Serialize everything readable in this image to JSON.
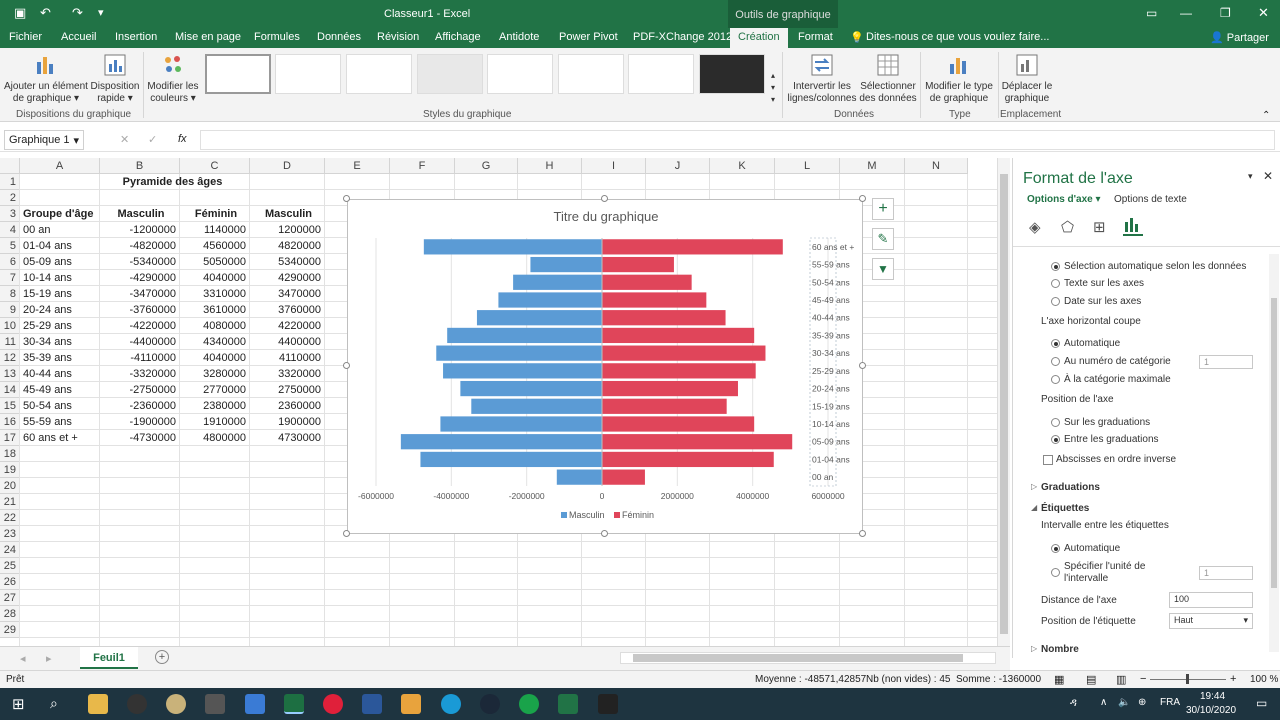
{
  "window": {
    "title": "Classeur1 - Excel",
    "context_tab_group": "Outils de graphique",
    "share": "Partager"
  },
  "tabs": [
    "Fichier",
    "Accueil",
    "Insertion",
    "Mise en page",
    "Formules",
    "Données",
    "Révision",
    "Affichage",
    "Antidote",
    "Power Pivot",
    "PDF-XChange 2012",
    "Création",
    "Format"
  ],
  "tell_me": "Dites-nous ce que vous voulez faire...",
  "ribbon": {
    "add_element": "Ajouter un élément de graphique",
    "quick_layout": "Disposition rapide",
    "change_colors": "Modifier les couleurs",
    "switch_rowcol": "Intervertir les lignes/colonnes",
    "select_data": "Sélectionner des données",
    "change_type": "Modifier le type de graphique",
    "move_chart": "Déplacer le graphique",
    "group_layouts": "Dispositions du graphique",
    "group_styles": "Styles du graphique",
    "group_data": "Données",
    "group_type": "Type",
    "group_location": "Emplacement"
  },
  "namebox": "Graphique 1",
  "fx": "fx",
  "columns": [
    "A",
    "B",
    "C",
    "D",
    "E",
    "F",
    "G",
    "H",
    "I",
    "J",
    "K",
    "L",
    "M",
    "N"
  ],
  "rows": [
    "1",
    "2",
    "3",
    "4",
    "5",
    "6",
    "7",
    "8",
    "9",
    "10",
    "11",
    "12",
    "13",
    "14",
    "15",
    "16",
    "17",
    "18",
    "19",
    "20",
    "21",
    "22",
    "23",
    "24",
    "25",
    "26",
    "27",
    "28",
    "29"
  ],
  "sheet_title": "Pyramide des âges",
  "table_headers": [
    "Groupe d'âge",
    "Masculin",
    "Féminin",
    "Masculin"
  ],
  "table_rows": [
    [
      "00 an",
      "-1200000",
      "1140000",
      "1200000"
    ],
    [
      "01-04 ans",
      "-4820000",
      "4560000",
      "4820000"
    ],
    [
      "05-09 ans",
      "-5340000",
      "5050000",
      "5340000"
    ],
    [
      "10-14 ans",
      "-4290000",
      "4040000",
      "4290000"
    ],
    [
      "15-19 ans",
      "-3470000",
      "3310000",
      "3470000"
    ],
    [
      "20-24 ans",
      "-3760000",
      "3610000",
      "3760000"
    ],
    [
      "25-29 ans",
      "-4220000",
      "4080000",
      "4220000"
    ],
    [
      "30-34 ans",
      "-4400000",
      "4340000",
      "4400000"
    ],
    [
      "35-39 ans",
      "-4110000",
      "4040000",
      "4110000"
    ],
    [
      "40-44 ans",
      "-3320000",
      "3280000",
      "3320000"
    ],
    [
      "45-49 ans",
      "-2750000",
      "2770000",
      "2750000"
    ],
    [
      "50-54 ans",
      "-2360000",
      "2380000",
      "2360000"
    ],
    [
      "55-59 ans",
      "-1900000",
      "1910000",
      "1900000"
    ],
    [
      "60 ans et +",
      "-4730000",
      "4800000",
      "4730000"
    ]
  ],
  "chart_data": {
    "type": "bar",
    "orientation": "horizontal",
    "title": "Titre du graphique",
    "categories": [
      "00 an",
      "01-04 ans",
      "05-09 ans",
      "10-14 ans",
      "15-19 ans",
      "20-24 ans",
      "25-29 ans",
      "30-34 ans",
      "35-39 ans",
      "40-44 ans",
      "45-49 ans",
      "50-54 ans",
      "55-59 ans",
      "60 ans et +"
    ],
    "series": [
      {
        "name": "Masculin",
        "color": "#5b9bd5",
        "values": [
          -1200000,
          -4820000,
          -5340000,
          -4290000,
          -3470000,
          -3760000,
          -4220000,
          -4400000,
          -4110000,
          -3320000,
          -2750000,
          -2360000,
          -1900000,
          -4730000
        ]
      },
      {
        "name": "Féminin",
        "color": "#e0455a",
        "values": [
          1140000,
          4560000,
          5050000,
          4040000,
          3310000,
          3610000,
          4080000,
          4340000,
          4040000,
          3280000,
          2770000,
          2380000,
          1910000,
          4800000
        ]
      }
    ],
    "xticks": [
      "-6000000",
      "-4000000",
      "-2000000",
      "0",
      "2000000",
      "4000000",
      "6000000"
    ],
    "xlim": [
      -6000000,
      6000000
    ],
    "legend": "bottom",
    "category_labels": "right"
  },
  "pane": {
    "title": "Format de l'axe",
    "tab_axis": "Options d'axe",
    "tab_text": "Options de texte",
    "opt_auto_data": "Sélection automatique selon les données",
    "opt_text_axis": "Texte sur les axes",
    "opt_date_axis": "Date sur les axes",
    "crosses_label": "L'axe horizontal coupe",
    "opt_automatic": "Automatique",
    "opt_at_category": "Au numéro de catégorie",
    "at_category_value": "1",
    "opt_max_category": "À la catégorie maximale",
    "position_label": "Position de l'axe",
    "opt_on_ticks": "Sur les graduations",
    "opt_between_ticks": "Entre les graduations",
    "reverse": "Abscisses en ordre inverse",
    "graduations": "Graduations",
    "labels": "Étiquettes",
    "interval_label": "Intervalle entre les étiquettes",
    "opt_auto2": "Automatique",
    "opt_specify": "Spécifier l'unité de l'intervalle",
    "specify_value": "1",
    "distance_label": "Distance de l'axe",
    "distance_value": "100",
    "label_pos_label": "Position de l'étiquette",
    "label_pos_value": "Haut",
    "number": "Nombre"
  },
  "sheet_tab": "Feuil1",
  "status": {
    "ready": "Prêt",
    "average": "Moyenne : -48571,42857",
    "count": "Nb (non vides) : 45",
    "sum": "Somme : -1360000",
    "zoom": "100 %"
  },
  "taskbar": {
    "lang": "FRA",
    "time": "19:44",
    "date": "30/10/2020"
  }
}
